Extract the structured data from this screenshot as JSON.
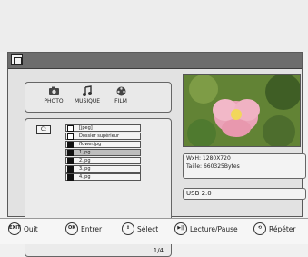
{
  "title_bar": {
    "icon": "photo-frame-icon"
  },
  "tabs": [
    {
      "label": "PHOTO",
      "icon": "camera-icon"
    },
    {
      "label": "MUSIQUE",
      "icon": "music-icon"
    },
    {
      "label": "FILM",
      "icon": "film-icon"
    }
  ],
  "drive": "C:",
  "files": [
    {
      "name": "[jpeg]",
      "type": "folder"
    },
    {
      "name": "Dossier supérieur",
      "type": "folder"
    },
    {
      "name": "flower.jpg",
      "type": "file"
    },
    {
      "name": "1.jpg",
      "type": "file",
      "selected": true
    },
    {
      "name": "2.jpg",
      "type": "file"
    },
    {
      "name": "3.jpg",
      "type": "file"
    },
    {
      "name": "4.jpg",
      "type": "file"
    }
  ],
  "page_indicator": "1/4",
  "info": {
    "size": "WxH:  1280X720",
    "bytes": "Taille: 660325Bytes"
  },
  "usb": "USB 2.0",
  "hints": [
    {
      "key": "EXIT",
      "label": "Quit"
    },
    {
      "key": "OK",
      "label": "Entrer"
    },
    {
      "key": "⇕",
      "label": "Sélect"
    },
    {
      "key": "▶||",
      "label": "Lecture/Pause"
    },
    {
      "key": "⟲",
      "label": "Répéter"
    }
  ]
}
